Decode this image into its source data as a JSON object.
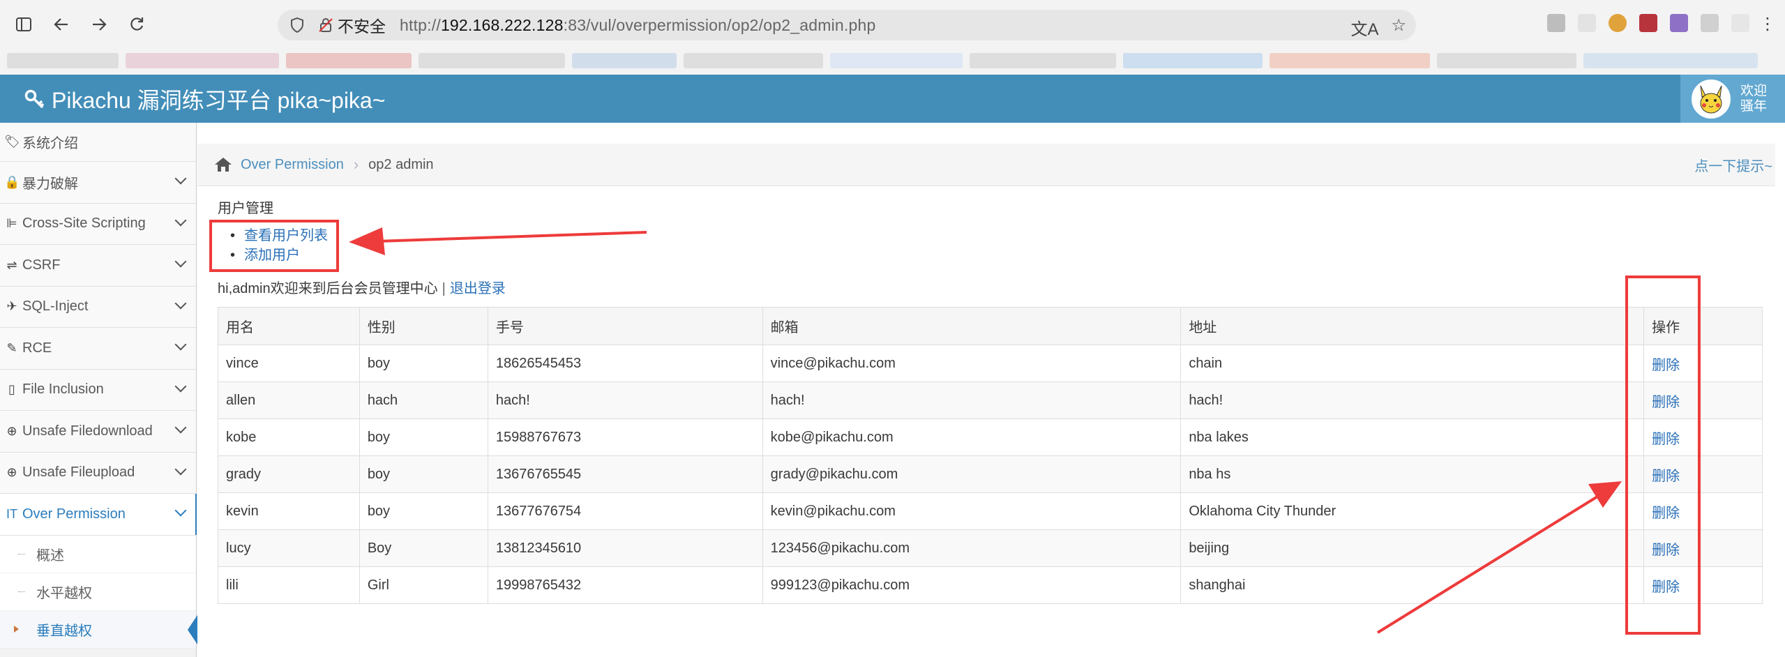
{
  "browser": {
    "insecure_label": "不安全",
    "url_prefix": "http://",
    "url_host": "192.168.222.128",
    "url_rest": ":83/vul/overpermission/op2/op2_admin.php"
  },
  "header": {
    "title": "Pikachu 漏洞练习平台 pika~pika~",
    "welcome_line1": "欢迎",
    "welcome_line2": "骚年"
  },
  "sidebar": {
    "items": [
      {
        "label": "系统介绍"
      },
      {
        "label": "暴力破解"
      },
      {
        "label": "Cross-Site Scripting"
      },
      {
        "label": "CSRF"
      },
      {
        "label": "SQL-Inject"
      },
      {
        "label": "RCE"
      },
      {
        "label": "File Inclusion"
      },
      {
        "label": "Unsafe Filedownload"
      },
      {
        "label": "Unsafe Fileupload"
      },
      {
        "label": "Over Permission"
      }
    ],
    "subitems": [
      {
        "label": "概述"
      },
      {
        "label": "水平越权"
      },
      {
        "label": "垂直越权"
      }
    ]
  },
  "breadcrumb": {
    "section": "Over Permission",
    "current": "op2 admin",
    "hint": "点一下提示~"
  },
  "main": {
    "section_title": "用户管理",
    "links": [
      "查看用户列表",
      "添加用户"
    ],
    "welcome": "hi,admin欢迎来到后台会员管理中心",
    "separator": "|",
    "logout": "退出登录"
  },
  "table": {
    "headers": [
      "用名",
      "性别",
      "手号",
      "邮箱",
      "地址",
      "操作"
    ],
    "delete_label": "删除",
    "rows": [
      [
        "vince",
        "boy",
        "18626545453",
        "vince@pikachu.com",
        "chain"
      ],
      [
        "allen",
        "hach",
        "hach!",
        "hach!",
        "hach!"
      ],
      [
        "kobe",
        "boy",
        "15988767673",
        "kobe@pikachu.com",
        "nba lakes"
      ],
      [
        "grady",
        "boy",
        "13676765545",
        "grady@pikachu.com",
        "nba hs"
      ],
      [
        "kevin",
        "boy",
        "13677676754",
        "kevin@pikachu.com",
        "Oklahoma City Thunder"
      ],
      [
        "lucy",
        "Boy",
        "13812345610",
        "123456@pikachu.com",
        "beijing"
      ],
      [
        "lili",
        "Girl",
        "19998765432",
        "999123@pikachu.com",
        "shanghai"
      ]
    ]
  },
  "colors": {
    "header_blue": "#438eb9",
    "link_blue": "#2a70b8",
    "annotation_red": "#ee3b3b"
  }
}
